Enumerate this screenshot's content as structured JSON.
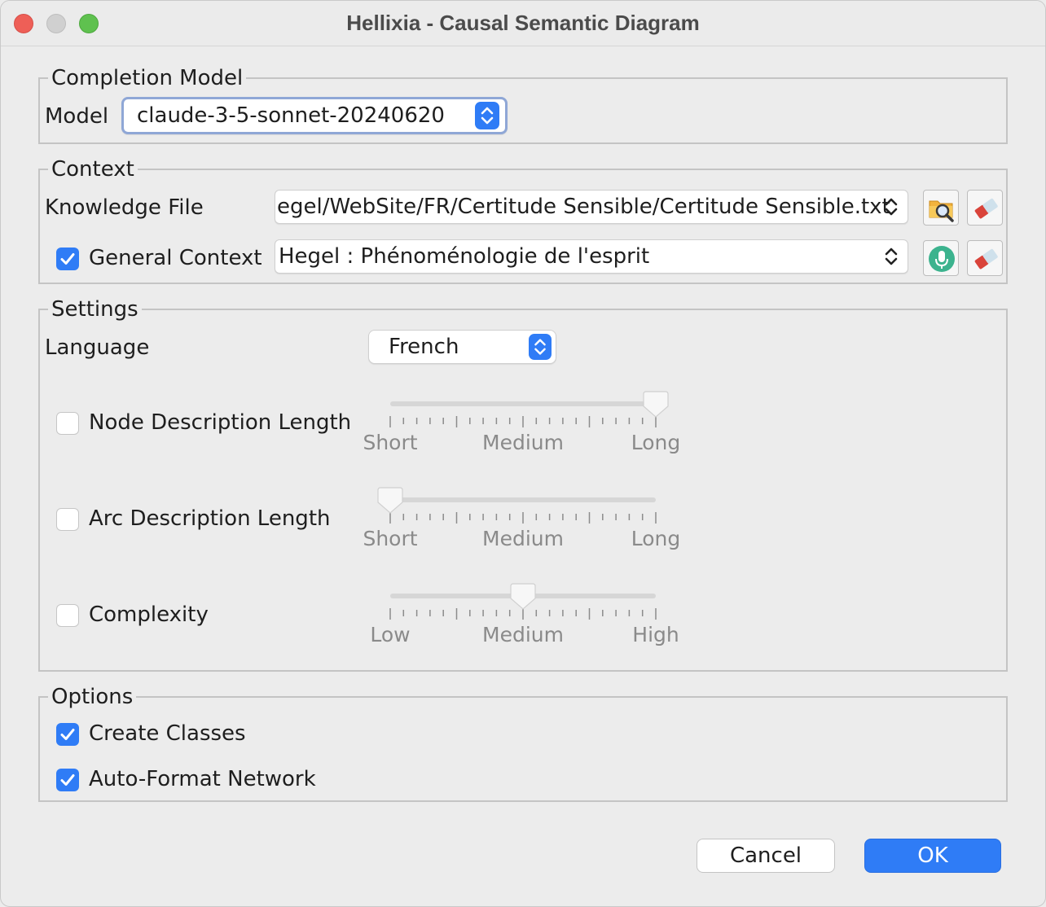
{
  "window": {
    "title": "Hellixia - Causal Semantic Diagram"
  },
  "completion_model": {
    "legend": "Completion Model",
    "model_label": "Model",
    "model_value": "claude-3-5-sonnet-20240620"
  },
  "context": {
    "legend": "Context",
    "knowledge_file_label": "Knowledge File",
    "knowledge_file_value": "egel/WebSite/FR/Certitude Sensible/Certitude Sensible.txt",
    "general_context_label": "General Context",
    "general_context_checked": true,
    "general_context_value": "Hegel : Phénoménologie de l'esprit",
    "icons": [
      "browse-file-icon",
      "eraser-icon",
      "microphone-icon",
      "eraser-icon"
    ]
  },
  "settings": {
    "legend": "Settings",
    "language_label": "Language",
    "language_value": "French",
    "node_description": {
      "label": "Node Description Length",
      "checked": false,
      "level": 1.0,
      "labels": [
        "Short",
        "Medium",
        "Long"
      ]
    },
    "arc_description": {
      "label": "Arc Description Length",
      "checked": false,
      "level": 0.0,
      "labels": [
        "Short",
        "Medium",
        "Long"
      ]
    },
    "complexity": {
      "label": "Complexity",
      "checked": false,
      "level": 0.5,
      "labels": [
        "Low",
        "Medium",
        "High"
      ]
    }
  },
  "options": {
    "legend": "Options",
    "create_classes_label": "Create Classes",
    "create_classes_checked": true,
    "auto_format_label": "Auto-Format Network",
    "auto_format_checked": true
  },
  "buttons": {
    "cancel": "Cancel",
    "ok": "OK"
  },
  "colors": {
    "accent": "#2f7cf6",
    "close": "#ee5f57",
    "maximize": "#5fc14f"
  }
}
